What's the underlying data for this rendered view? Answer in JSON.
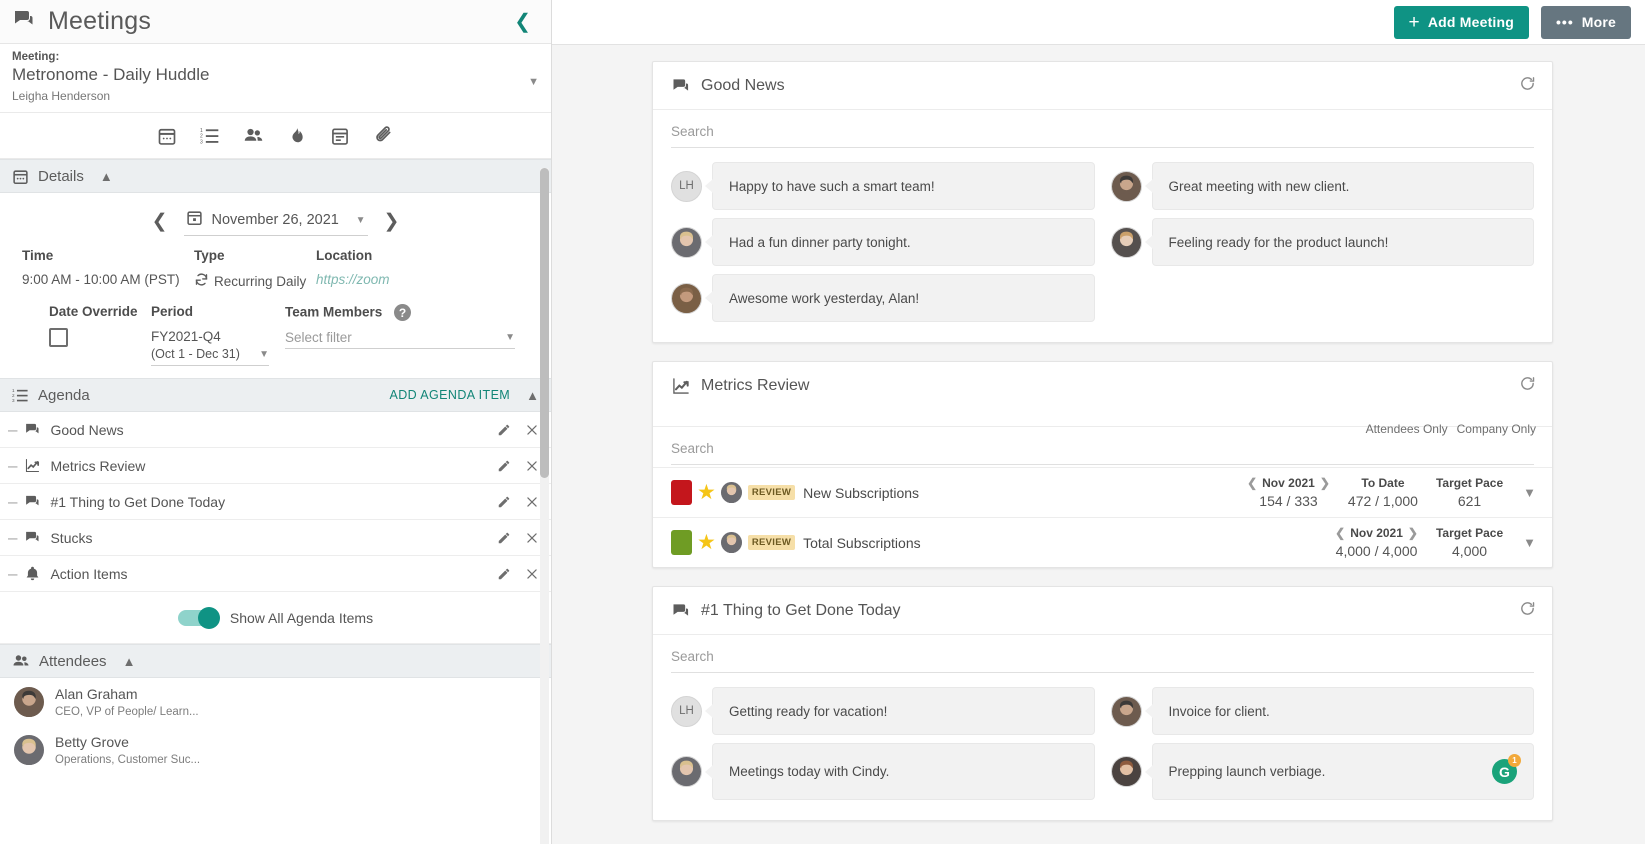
{
  "sidebar": {
    "title": "Meetings",
    "collapse_icon": "chevron-left-icon",
    "meeting": {
      "label": "Meeting:",
      "name": "Metronome - Daily Huddle",
      "owner": "Leigha Henderson"
    },
    "toolbar_icons": [
      "calendar-icon",
      "numbered-list-icon",
      "people-icon",
      "flame-icon",
      "notes-icon",
      "paperclip-icon"
    ],
    "details": {
      "section_title": "Details",
      "date": "November 26, 2021",
      "prev_icon": "chevron-left-icon",
      "next_icon": "chevron-right-icon",
      "headers": {
        "time": "Time",
        "type": "Type",
        "location": "Location"
      },
      "time": "9:00 AM - 10:00 AM (PST)",
      "type": "Recurring Daily",
      "location": "https://zoom",
      "date_override_label": "Date Override",
      "period_label": "Period",
      "period_value": "FY2021-Q4",
      "period_range": "(Oct 1 - Dec 31)",
      "team_members_label": "Team Members",
      "team_members_placeholder": "Select filter"
    },
    "agenda": {
      "section_title": "Agenda",
      "add_label": "ADD AGENDA ITEM",
      "items": [
        {
          "label": "Good News",
          "icon": "chat-icon"
        },
        {
          "label": "Metrics Review",
          "icon": "chart-icon"
        },
        {
          "label": "#1 Thing to Get Done Today",
          "icon": "chat-icon"
        },
        {
          "label": "Stucks",
          "icon": "chat-icon"
        },
        {
          "label": "Action Items",
          "icon": "bell-icon"
        }
      ],
      "toggle_label": "Show All Agenda Items",
      "toggle_on": true
    },
    "attendees": {
      "section_title": "Attendees",
      "items": [
        {
          "name": "Alan Graham",
          "role": "CEO, VP of People/ Learn..."
        },
        {
          "name": "Betty Grove",
          "role": "Operations, Customer Suc..."
        }
      ]
    }
  },
  "topbar": {
    "add_meeting_label": "Add Meeting",
    "add_icon": "plus-icon",
    "more_label": "More",
    "more_icon": "ellipsis-icon"
  },
  "cards": {
    "good_news": {
      "title": "Good News",
      "icon": "chat-icon",
      "refresh_icon": "refresh-icon",
      "search_placeholder": "Search",
      "messages": [
        {
          "initials": "LH",
          "avatar": "initials",
          "text": "Happy to have such a smart team!"
        },
        {
          "initials": "",
          "avatar": "photo-male-1",
          "text": "Great meeting with new client."
        },
        {
          "initials": "",
          "avatar": "photo-female-1",
          "text": "Had a fun dinner party tonight."
        },
        {
          "initials": "",
          "avatar": "photo-female-2",
          "text": "Feeling ready for the product launch!"
        },
        {
          "initials": "",
          "avatar": "photo-male-2",
          "text": "Awesome work yesterday, Alan!"
        }
      ]
    },
    "metrics_review": {
      "title": "Metrics Review",
      "icon": "chart-icon",
      "refresh_icon": "refresh-icon",
      "filter_attendees": "Attendees Only",
      "filter_company": "Company Only",
      "search_placeholder": "Search",
      "rows": [
        {
          "status_color": "#c4161c",
          "starred": true,
          "tag": "REVIEW",
          "name": "New Subscriptions",
          "columns": [
            {
              "header": "Nov 2021",
              "value": "154 / 333",
              "nav": true
            },
            {
              "header": "To Date",
              "value": "472 / 1,000",
              "nav": false
            },
            {
              "header": "Target Pace",
              "value": "621",
              "nav": false
            }
          ]
        },
        {
          "status_color": "#6f9c24",
          "starred": true,
          "tag": "REVIEW",
          "name": "Total Subscriptions",
          "columns": [
            {
              "header": "Nov 2021",
              "value": "4,000 / 4,000",
              "nav": true
            },
            {
              "header": "Target Pace",
              "value": "4,000",
              "nav": false
            }
          ]
        }
      ]
    },
    "thing_today": {
      "title": "#1 Thing to Get Done Today",
      "icon": "chat-icon",
      "refresh_icon": "refresh-icon",
      "search_placeholder": "Search",
      "messages": [
        {
          "initials": "LH",
          "avatar": "initials",
          "text": "Getting ready for vacation!",
          "badge": ""
        },
        {
          "initials": "",
          "avatar": "photo-male-1",
          "text": "Invoice for client.",
          "badge": ""
        },
        {
          "initials": "",
          "avatar": "photo-female-1",
          "text": "Meetings today with Cindy.",
          "badge": ""
        },
        {
          "initials": "",
          "avatar": "photo-female-3",
          "text": "Prepping launch verbiage.",
          "badge": "G",
          "badge_count": "1"
        }
      ]
    }
  },
  "colors": {
    "accent": "#0f9384",
    "more_button": "#667680",
    "link": "#7fb8b0",
    "star": "#f5c518",
    "tag_bg": "#f6dfa8"
  }
}
